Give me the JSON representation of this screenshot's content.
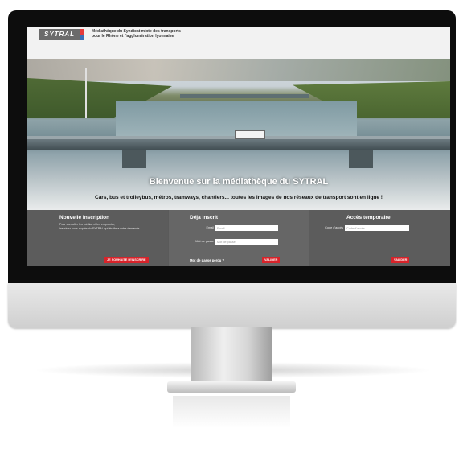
{
  "header": {
    "logo_text": "SYTRAL",
    "tagline_line1": "Médiathèque du Syndicat mixte des transports",
    "tagline_line2": "pour le Rhône et l'agglomération lyonnaise"
  },
  "hero": {
    "title": "Bienvenue sur la médiathèque du SYTRAL",
    "subtitle": "Cars, bus et trolleybus, métros, tramways, chantiers... toutes les images de nos réseaux de transport sont en ligne !"
  },
  "register": {
    "title": "Nouvelle inscription",
    "text_line1": "Pour consulter les médias et les emprunter,",
    "text_line2": "inscrivez-vous auprès du SYTRAL qui étudiera votre demande.",
    "button": "JE SOUHAITE M'INSCRIRE"
  },
  "login": {
    "title": "Déjà inscrit",
    "email_label": "Email",
    "email_placeholder": "Email",
    "password_label": "Mot de passe",
    "password_placeholder": "Mot de passe",
    "forgot_link": "Mot de passe perdu ?",
    "button": "VALIDER"
  },
  "temporary": {
    "title": "Accès temporaire",
    "code_label": "Code d'accès",
    "code_placeholder": "Code d'accès",
    "button": "VALIDER"
  },
  "colors": {
    "accent": "#d8232a",
    "panel_bg": "#5c5c5c"
  }
}
